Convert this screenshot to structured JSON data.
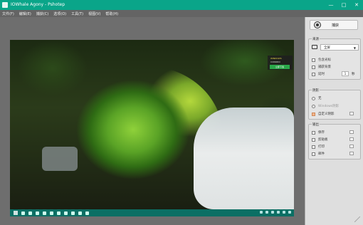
{
  "window": {
    "title": "IOWhale Agony - Pshotep",
    "minimize_glyph": "—",
    "maximize_glyph": "□",
    "close_glyph": "✕"
  },
  "menu": {
    "items": [
      "文件(F)",
      "编辑(E)",
      "捕获(C)",
      "选项(O)",
      "工具(T)",
      "视图(V)",
      "帮助(H)"
    ]
  },
  "panel": {
    "capture_button": {
      "label": "捕获"
    },
    "region_group": {
      "title": "来源",
      "select_value": "全屏",
      "checkboxes": [
        "包含光标",
        "捕获背景",
        "延时"
      ],
      "delay_value": "1",
      "delay_unit": "秒"
    },
    "shadow_group": {
      "title": "阴影",
      "options": [
        "无",
        "Windows阴影",
        "自定义阴影"
      ]
    },
    "output_group": {
      "title": "输出",
      "checkboxes": [
        "保存",
        "剪贴板",
        "打印",
        "邮件"
      ]
    }
  },
  "screenshot": {
    "watermark_line1": "WINDOWS",
    "watermark_line2": "CONODO",
    "watermark_button": "立即下载"
  },
  "colors": {
    "titlebar": "#0aa589",
    "menubar": "#646464",
    "canvas": "#6e6e6e",
    "panel": "#dedede"
  }
}
